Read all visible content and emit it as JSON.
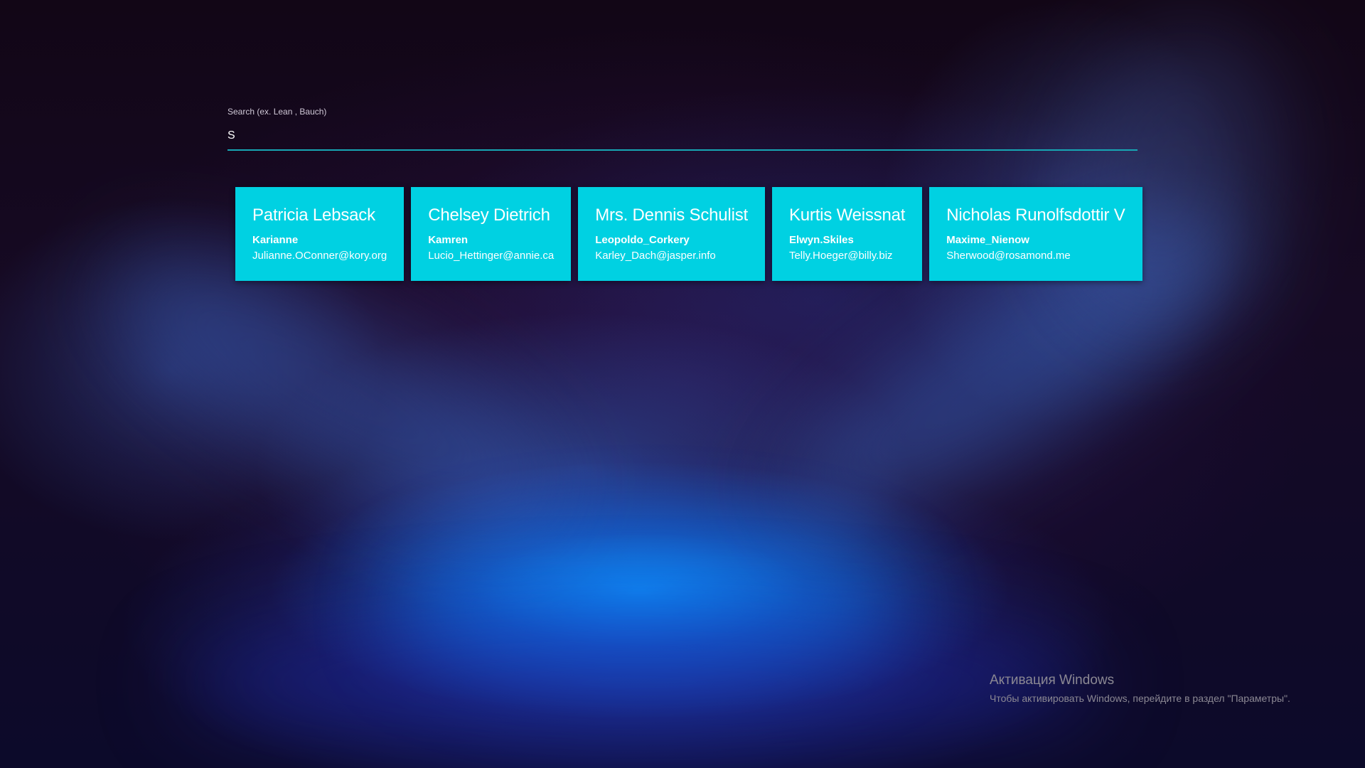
{
  "search": {
    "label": "Search (ex. Lean , Bauch)",
    "value": "S"
  },
  "cards": [
    {
      "name": "Patricia Lebsack",
      "username": "Karianne",
      "email": "Julianne.OConner@kory.org"
    },
    {
      "name": "Chelsey Dietrich",
      "username": "Kamren",
      "email": "Lucio_Hettinger@annie.ca"
    },
    {
      "name": "Mrs. Dennis Schulist",
      "username": "Leopoldo_Corkery",
      "email": "Karley_Dach@jasper.info"
    },
    {
      "name": "Kurtis Weissnat",
      "username": "Elwyn.Skiles",
      "email": "Telly.Hoeger@billy.biz"
    },
    {
      "name": "Nicholas Runolfsdottir V",
      "username": "Maxime_Nienow",
      "email": "Sherwood@rosamond.me"
    }
  ],
  "activation": {
    "title": "Активация Windows",
    "text": "Чтобы активировать Windows, перейдите в раздел \"Параметры\"."
  },
  "colors": {
    "card_background": "#00d1e2",
    "input_underline": "#17a7b4",
    "text": "#ffffff"
  }
}
